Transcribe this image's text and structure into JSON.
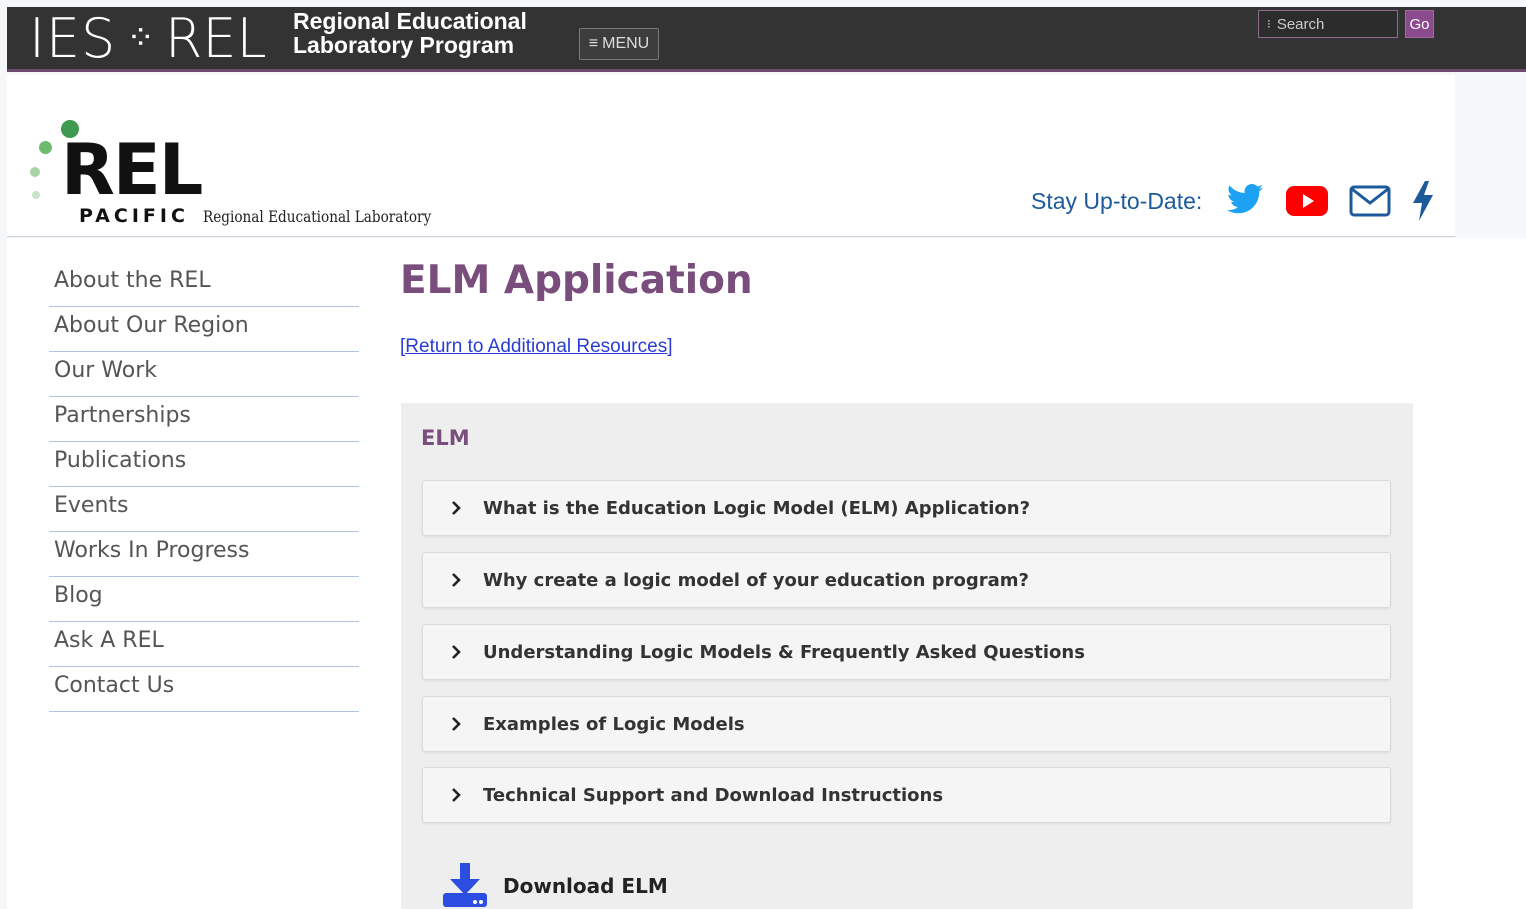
{
  "topbar": {
    "ies": "IES",
    "separator": "⁘",
    "rel": "REL",
    "program_line1": "Regional Educational",
    "program_line2": "Laboratory Program",
    "menu_label": "MENU",
    "search_placeholder": "Search",
    "go_label": "Go"
  },
  "header": {
    "logo_main": "REL",
    "logo_pacific": "PACIFIC",
    "logo_sub": "Regional Educational Laboratory",
    "stay_label": "Stay Up-to-Date:",
    "social_icons": [
      "twitter-icon",
      "youtube-icon",
      "email-icon",
      "lightning-icon"
    ]
  },
  "sidebar": {
    "items": [
      {
        "label": "About the REL"
      },
      {
        "label": "About Our Region"
      },
      {
        "label": "Our Work"
      },
      {
        "label": "Partnerships"
      },
      {
        "label": "Publications"
      },
      {
        "label": "Events"
      },
      {
        "label": "Works In Progress"
      },
      {
        "label": "Blog"
      },
      {
        "label": "Ask A REL"
      },
      {
        "label": "Contact Us"
      }
    ]
  },
  "main": {
    "title": "ELM Application",
    "return_link": "[Return to Additional Resources]",
    "panel_title": "ELM",
    "accordions": [
      {
        "label": "What is the Education Logic Model (ELM) Application?"
      },
      {
        "label": "Why create a logic model of your education program?"
      },
      {
        "label": "Understanding Logic Models & Frequently Asked Questions"
      },
      {
        "label": "Examples of Logic Models"
      },
      {
        "label": "Technical Support and Download Instructions"
      }
    ],
    "download_label": "Download ELM"
  },
  "colors": {
    "accent_purple": "#7a4e7c",
    "topbar_bg": "#333333",
    "link_blue": "#2a3cd4",
    "stay_blue": "#1c5a9c",
    "twitter": "#1da1f2",
    "youtube": "#ff0000",
    "download_blue": "#2b4de0"
  }
}
